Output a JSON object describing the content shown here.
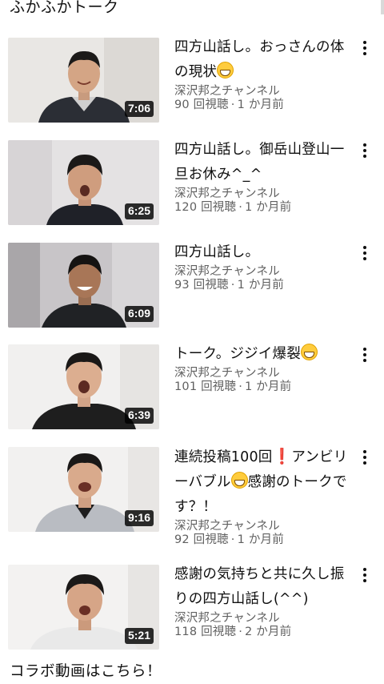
{
  "section": {
    "title": "ふかふかトーク"
  },
  "videos": [
    {
      "title_a": "四方山話し。おっさんの体の現状",
      "title_b": "",
      "emoji": "grinning-face",
      "channel": "深沢邦之チャンネル",
      "views": "90 回視聴",
      "age": "1 か月前",
      "duration": "7:06"
    },
    {
      "title_a": "四方山話し。御岳山登山一旦お休み^_^",
      "title_b": "",
      "channel": "深沢邦之チャンネル",
      "views": "120 回視聴",
      "age": "1 か月前",
      "duration": "6:25"
    },
    {
      "title_a": "四方山話し。",
      "title_b": "",
      "channel": "深沢邦之チャンネル",
      "views": "93 回視聴",
      "age": "1 か月前",
      "duration": "6:09"
    },
    {
      "title_a": "トーク。ジジイ爆裂",
      "title_b": "",
      "emoji": "grinning-face",
      "channel": "深沢邦之チャンネル",
      "views": "101 回視聴",
      "age": "1 か月前",
      "duration": "6:39"
    },
    {
      "title_a": "連続投稿100回",
      "mark": "❗",
      "title_b": "アンビリーバブル",
      "title_c": "感謝のトークです？！",
      "emoji": "grinning-face",
      "channel": "深沢邦之チャンネル",
      "views": "92 回視聴",
      "age": "1 か月前",
      "duration": "9:16"
    },
    {
      "title_a": "感謝の気持ちと共に久し振りの四方山話し(^^)",
      "title_b": "",
      "channel": "深沢邦之チャンネル",
      "views": "118 回視聴",
      "age": "2 か月前",
      "duration": "5:21"
    }
  ],
  "separator": "·",
  "footer": {
    "title": "コラボ動画はこちら！"
  },
  "colors": {
    "text": "#0f0f0f",
    "secondary": "#606060",
    "background": "#ffffff",
    "duration_bg": "#000000"
  }
}
